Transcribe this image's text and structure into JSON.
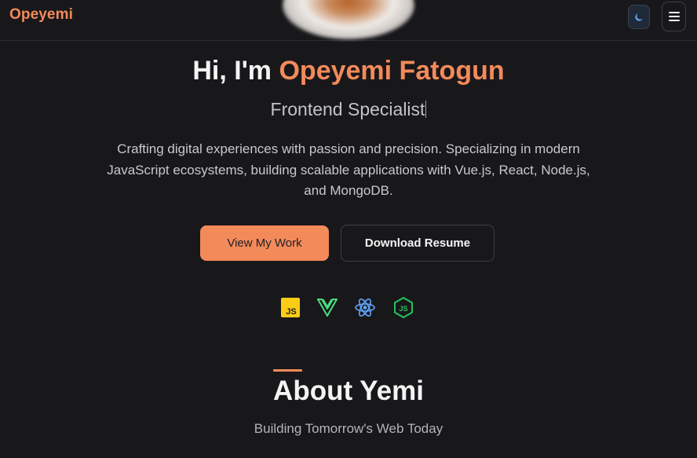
{
  "navbar": {
    "brand": "Opeyemi",
    "theme_icon": "moon-icon",
    "menu_icon": "hamburger-menu-icon"
  },
  "hero": {
    "greeting": "Hi, I'm ",
    "name": "Opeyemi Fatogun",
    "role": "Frontend Specialist",
    "description": "Crafting digital experiences with passion and precision. Specializing in modern JavaScript ecosystems, building scalable applications with Vue.js, React, Node.js, and MongoDB.",
    "primary_button": "View My Work",
    "secondary_button": "Download Resume"
  },
  "tech_stack": [
    {
      "name": "JavaScript",
      "icon": "javascript-icon"
    },
    {
      "name": "Vue.js",
      "icon": "vue-icon"
    },
    {
      "name": "React",
      "icon": "react-icon"
    },
    {
      "name": "Node.js",
      "icon": "nodejs-icon"
    }
  ],
  "about": {
    "title": "About Yemi",
    "subtitle": "Building Tomorrow's Web Today"
  },
  "colors": {
    "background": "#18181b",
    "accent": "#f38a5a",
    "text": "#f4f4f5",
    "muted": "#c9c9cd"
  }
}
